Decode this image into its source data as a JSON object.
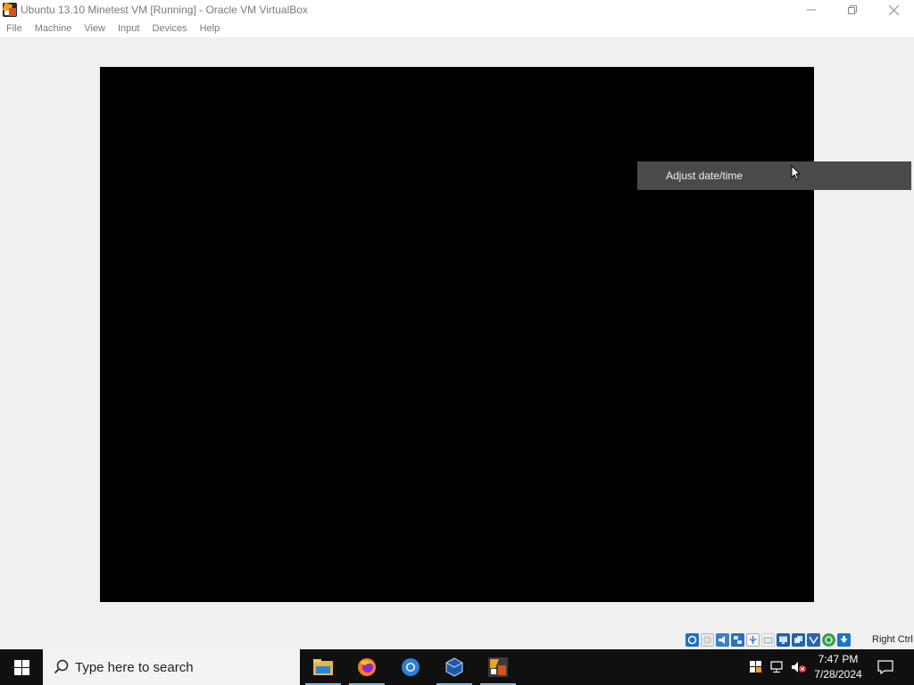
{
  "window": {
    "title": "Ubuntu 13.10 Minetest VM [Running] - Oracle VM VirtualBox",
    "controls": {
      "minimize": "—",
      "maximize": "❐",
      "close": "✕"
    }
  },
  "menu": {
    "items": [
      {
        "label": "File"
      },
      {
        "label": "Machine"
      },
      {
        "label": "View"
      },
      {
        "label": "Input"
      },
      {
        "label": "Devices"
      },
      {
        "label": "Help"
      }
    ]
  },
  "vm": {
    "context_menu": {
      "item": "Adjust date/time"
    }
  },
  "statusbar": {
    "icons": [
      "hard-disk-icon",
      "optical-drive-icon",
      "audio-icon",
      "network-icon",
      "usb-icon",
      "shared-folders-icon",
      "display-icon",
      "video-capture-icon",
      "virtualization-icon",
      "mouse-integration-icon",
      "host-key-icon"
    ],
    "host_key": "Right Ctrl"
  },
  "taskbar": {
    "search_placeholder": "Type here to search",
    "apps": [
      "file-explorer-icon",
      "firefox-icon",
      "chrome-icon",
      "virtualbox-icon",
      "vm-window-icon"
    ],
    "time": "7:47 PM",
    "date": "7/28/2024"
  },
  "colors": {
    "taskbar": "#101010",
    "context_menu": "#4a4a4a",
    "vm_screen": "#000000"
  }
}
